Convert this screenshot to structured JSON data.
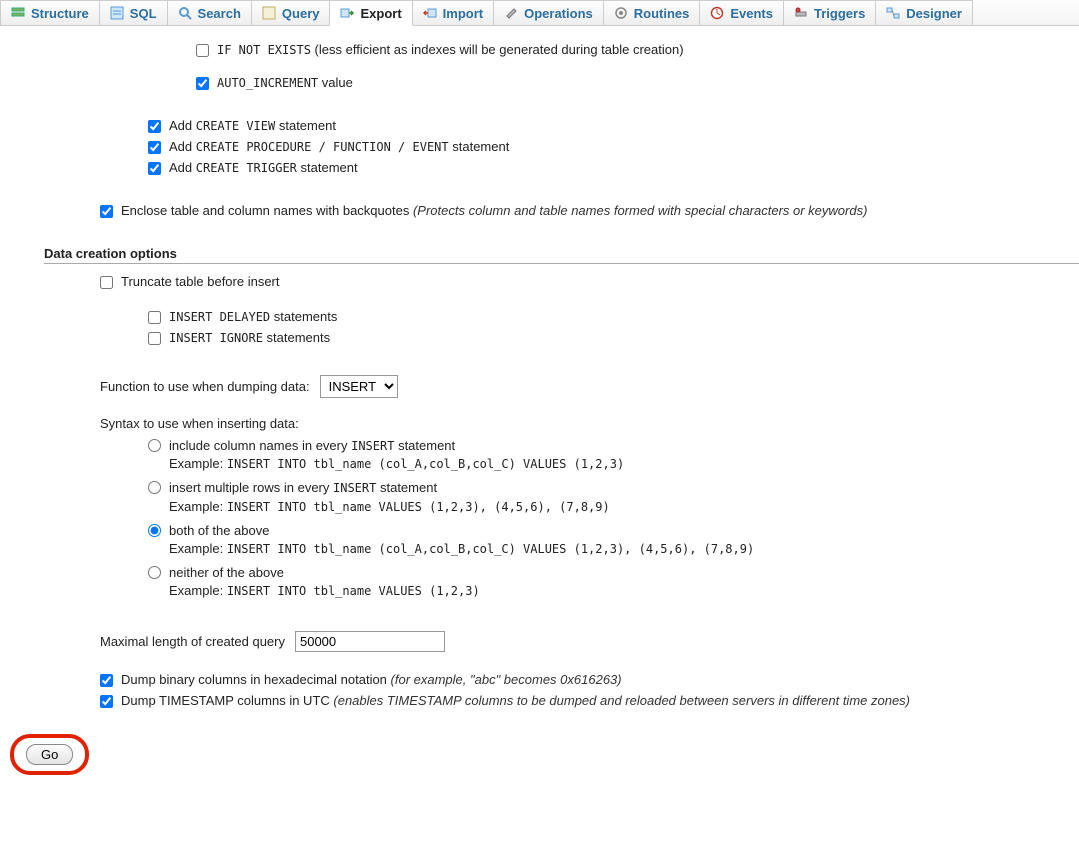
{
  "tabs": {
    "structure": "Structure",
    "sql": "SQL",
    "search": "Search",
    "query": "Query",
    "export": "Export",
    "import": "Import",
    "operations": "Operations",
    "routines": "Routines",
    "events": "Events",
    "triggers": "Triggers",
    "designer": "Designer"
  },
  "opt": {
    "if_not_exists_code": "IF NOT EXISTS",
    "if_not_exists_note": " (less efficient as indexes will be generated during table creation)",
    "auto_increment_code": "AUTO_INCREMENT",
    "auto_increment_suffix": " value",
    "create_view_prefix": "Add ",
    "create_view_code": "CREATE VIEW",
    "create_view_suffix": " statement",
    "create_proc_prefix": "Add ",
    "create_proc_code": "CREATE PROCEDURE / FUNCTION / EVENT",
    "create_proc_suffix": " statement",
    "create_trigger_prefix": "Add ",
    "create_trigger_code": "CREATE TRIGGER",
    "create_trigger_suffix": " statement",
    "backquotes_label": "Enclose table and column names with backquotes ",
    "backquotes_hint": "(Protects column and table names formed with special characters or keywords)"
  },
  "data_section_title": "Data creation options",
  "data": {
    "truncate": "Truncate table before insert",
    "insert_delayed_code": "INSERT DELAYED",
    "insert_delayed_suffix": " statements",
    "insert_ignore_code": "INSERT IGNORE",
    "insert_ignore_suffix": " statements",
    "dump_func_label": "Function to use when dumping data:",
    "dump_func_value": "INSERT",
    "syntax_label": "Syntax to use when inserting data:",
    "radios": {
      "cols_label_a": "include column names in every ",
      "cols_label_code": "INSERT",
      "cols_label_b": " statement",
      "cols_example": "INSERT INTO tbl_name (col_A,col_B,col_C) VALUES (1,2,3)",
      "multi_label_a": "insert multiple rows in every ",
      "multi_label_code": "INSERT",
      "multi_label_b": " statement",
      "multi_example": "INSERT INTO tbl_name VALUES (1,2,3), (4,5,6), (7,8,9)",
      "both_label": "both of the above",
      "both_example": "INSERT INTO tbl_name (col_A,col_B,col_C) VALUES (1,2,3), (4,5,6), (7,8,9)",
      "neither_label": "neither of the above",
      "neither_example": "INSERT INTO tbl_name VALUES (1,2,3)"
    },
    "example_prefix": "Example: ",
    "maxlen_label": "Maximal length of created query",
    "maxlen_value": "50000",
    "hex_label": "Dump binary columns in hexadecimal notation ",
    "hex_hint": "(for example, \"abc\" becomes 0x616263)",
    "utc_label": "Dump TIMESTAMP columns in UTC ",
    "utc_hint": "(enables TIMESTAMP columns to be dumped and reloaded between servers in different time zones)"
  },
  "go_label": "Go"
}
